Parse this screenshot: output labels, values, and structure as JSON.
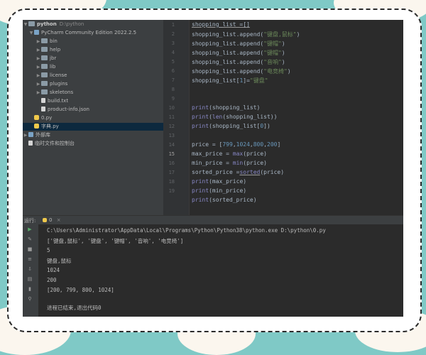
{
  "project_tree": {
    "root": {
      "name": "python",
      "path": "D:\\python"
    },
    "library": "PyCharm Community Edition 2022.2.5",
    "folders": [
      "bin",
      "help",
      "jbr",
      "lib",
      "license",
      "plugins",
      "skeletons"
    ],
    "files": [
      "build.txt",
      "product-info.json"
    ],
    "scripts": [
      "0.py",
      "字典.py"
    ],
    "external": "外部库",
    "scratches": "临时文件和控制台"
  },
  "editor": {
    "line_numbers": [
      "1",
      "2",
      "3",
      "4",
      "5",
      "6",
      "7",
      "8",
      "9",
      "10",
      "11",
      "12",
      "13",
      "14",
      "15",
      "16",
      "17",
      "18",
      "19"
    ],
    "code": {
      "l1": "shopping_list =[]",
      "l2_pre": "shopping_list.append(",
      "l2_s": "\"键盘,鼠标\"",
      "l2_post": ")",
      "l3_pre": "shopping_list.append(",
      "l3_s": "\"键帽\"",
      "l3_post": ")",
      "l4_pre": "shopping_list.append(",
      "l4_s": "\"键帽\"",
      "l4_post": ")",
      "l5_pre": "shopping_list.append(",
      "l5_s": "\"音响\"",
      "l5_post": ")",
      "l6_pre": "shopping_list.append(",
      "l6_s": "\"电竞椅\"",
      "l6_post": ")",
      "l7_pre": "shopping_list[",
      "l7_n": "1",
      "l7_mid": "]=",
      "l7_s": "\"键盘\"",
      "l9_f": "print",
      "l9_post": "(shopping_list)",
      "l10_f": "print",
      "l10_mid": "(",
      "l10_f2": "len",
      "l10_post": "(shopping_list))",
      "l11_f": "print",
      "l11_pre": "(shopping_list[",
      "l11_n": "0",
      "l11_post": "])",
      "l13_pre": "price = [",
      "l13_a": "799",
      "l13_b": "1024",
      "l13_c": "800",
      "l13_d": "200",
      "l13_post": "]",
      "l14_pre": "max_price = ",
      "l14_f": "max",
      "l14_post": "(price)",
      "l15_pre": "min_price = ",
      "l15_f": "min",
      "l15_post": "(price)",
      "l16_pre": "sorted_price =",
      "l16_f": "sorted",
      "l16_post": "(price)",
      "l17_f": "print",
      "l17_post": "(max_price)",
      "l18_f": "print",
      "l18_post": "(min_price)",
      "l19_f": "print",
      "l19_post": "(sorted_price)"
    }
  },
  "run": {
    "label": "运行:",
    "tab": "0",
    "close": "×",
    "output": [
      "C:\\Users\\Administrator\\AppData\\Local\\Programs\\Python\\Python38\\python.exe D:\\python\\0.py",
      "['键盘,鼠标', '键盘', '键帽', '音响', '电竞椅']",
      "5",
      "键盘,鼠标",
      "1024",
      "200",
      "[200, 799, 800, 1024]",
      "",
      "进程已结束,退出代码0"
    ]
  },
  "colors": {
    "background": "#7fc9c6",
    "ide": "#2b2b2b",
    "keyword_number": "#6897bb",
    "string": "#6a8759",
    "builtin": "#8888c6"
  }
}
